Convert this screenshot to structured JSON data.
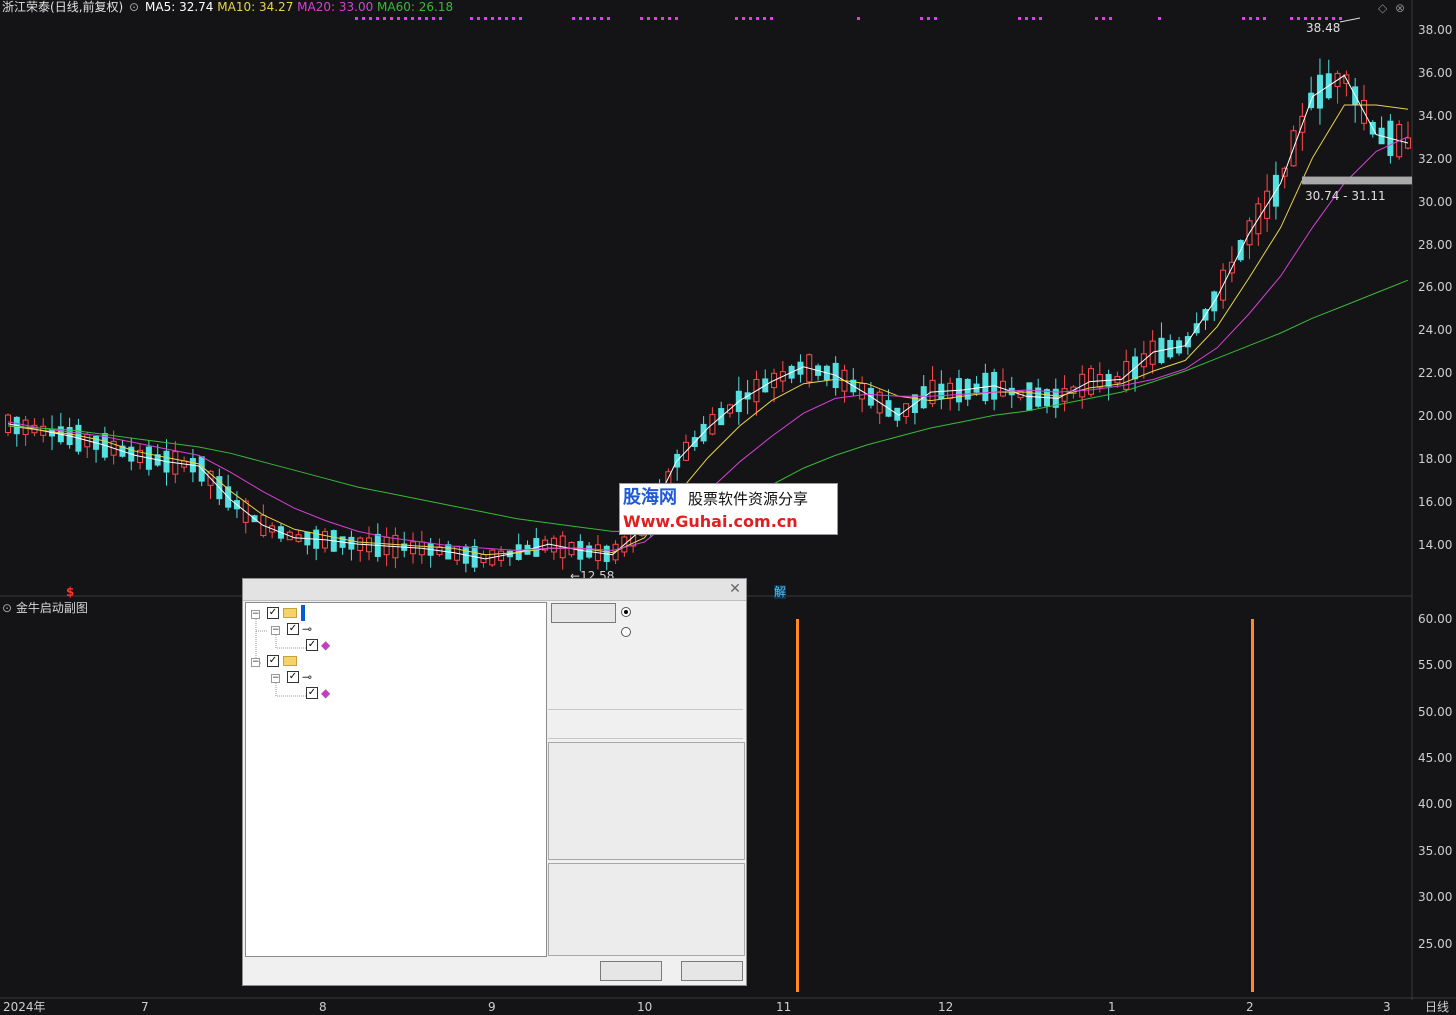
{
  "chart": {
    "stock_name": "浙江荣泰",
    "mode": "(日线,前复权)",
    "ma_legend": [
      {
        "label": "MA5:",
        "value": "32.74",
        "color": "#ffffff"
      },
      {
        "label": "MA10:",
        "value": "34.27",
        "color": "#e8d44a"
      },
      {
        "label": "MA20:",
        "value": "33.00",
        "color": "#d640d6"
      },
      {
        "label": "MA60:",
        "value": "26.18",
        "color": "#3ab83a"
      }
    ],
    "high_label": "38.48",
    "low_label": "12.58",
    "range_label": "30.74 - 31.11",
    "dollar_marker": "$",
    "jie_marker": "解",
    "price_ticks": [
      "38.00",
      "36.00",
      "34.00",
      "32.00",
      "30.00",
      "28.00",
      "26.00",
      "24.00",
      "22.00",
      "20.00",
      "18.00",
      "16.00",
      "14.00"
    ],
    "sub_title": "金牛启动副图",
    "sub_ticks": [
      "60.00",
      "55.00",
      "50.00",
      "45.00",
      "40.00",
      "35.00",
      "30.00",
      "25.00"
    ],
    "date_labels": [
      "2024年",
      "7",
      "8",
      "9",
      "10",
      "11",
      "12",
      "1",
      "2",
      "3"
    ],
    "period": "日线",
    "watermark_name": "股海网",
    "watermark_slogan": "股票软件资源分享",
    "watermark_url": "Www.Guhai.com.cn"
  },
  "chart_data": {
    "type": "candlestick",
    "title": "浙江荣泰 (日线,前复权)",
    "ylim": [
      12,
      39
    ],
    "series": [
      {
        "name": "MA5",
        "color": "#ffffff",
        "values": [
          19.4,
          19.1,
          18.8,
          18.4,
          17.9,
          17.6,
          17.4,
          15.8,
          14.6,
          14.0,
          13.9,
          13.7,
          13.6,
          13.5,
          13.3,
          13.0,
          13.3,
          13.7,
          13.4,
          13.2,
          14.5,
          17.6,
          19.2,
          20.5,
          21.4,
          22.1,
          21.7,
          20.8,
          19.8,
          20.9,
          21.0,
          21.2,
          20.7,
          20.6,
          21.4,
          21.5,
          22.8,
          23.1,
          25.4,
          28.4,
          30.8,
          34.9,
          35.9,
          33.1,
          32.7
        ]
      },
      {
        "name": "MA10",
        "color": "#e8d44a",
        "values": [
          19.3,
          19.1,
          18.9,
          18.6,
          18.1,
          17.8,
          17.5,
          16.2,
          15.1,
          14.4,
          14.1,
          13.8,
          13.7,
          13.6,
          13.5,
          13.2,
          13.3,
          13.5,
          13.5,
          13.3,
          14.0,
          16.0,
          17.8,
          19.3,
          20.5,
          21.3,
          21.5,
          21.3,
          20.7,
          20.5,
          20.7,
          20.9,
          20.9,
          20.7,
          21.1,
          21.3,
          21.9,
          22.4,
          24.0,
          26.3,
          28.7,
          32.0,
          34.5,
          34.5,
          34.3
        ]
      },
      {
        "name": "MA20",
        "color": "#d640d6",
        "values": [
          19.5,
          19.2,
          19.0,
          18.8,
          18.5,
          18.2,
          17.9,
          17.1,
          16.2,
          15.4,
          14.8,
          14.3,
          14.0,
          13.8,
          13.6,
          13.5,
          13.4,
          13.5,
          13.5,
          13.4,
          13.8,
          15.0,
          16.2,
          17.6,
          18.8,
          19.9,
          20.6,
          20.8,
          20.7,
          20.7,
          20.8,
          20.9,
          21.0,
          20.9,
          21.0,
          21.2,
          21.5,
          22.0,
          23.0,
          24.6,
          26.4,
          28.7,
          30.8,
          32.3,
          33.0
        ]
      },
      {
        "name": "MA60",
        "color": "#3ab83a",
        "values": [
          19.3,
          19.2,
          19.1,
          18.9,
          18.7,
          18.5,
          18.3,
          18.0,
          17.6,
          17.2,
          16.8,
          16.4,
          16.1,
          15.8,
          15.5,
          15.2,
          14.9,
          14.7,
          14.5,
          14.3,
          14.3,
          14.5,
          15.0,
          15.7,
          16.5,
          17.3,
          17.9,
          18.4,
          18.8,
          19.2,
          19.5,
          19.8,
          20.0,
          20.3,
          20.6,
          20.9,
          21.4,
          21.9,
          22.5,
          23.1,
          23.7,
          24.4,
          25.0,
          25.6,
          26.2
        ]
      }
    ]
  }
}
